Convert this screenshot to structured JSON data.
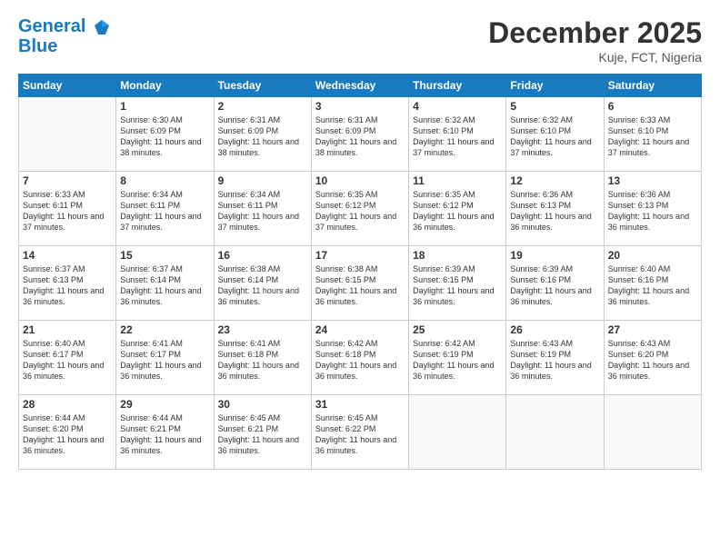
{
  "logo": {
    "line1": "General",
    "line2": "Blue"
  },
  "title": "December 2025",
  "location": "Kuje, FCT, Nigeria",
  "days_of_week": [
    "Sunday",
    "Monday",
    "Tuesday",
    "Wednesday",
    "Thursday",
    "Friday",
    "Saturday"
  ],
  "weeks": [
    [
      {
        "day": "",
        "empty": true
      },
      {
        "day": "1",
        "sunrise": "Sunrise: 6:30 AM",
        "sunset": "Sunset: 6:09 PM",
        "daylight": "Daylight: 11 hours and 38 minutes."
      },
      {
        "day": "2",
        "sunrise": "Sunrise: 6:31 AM",
        "sunset": "Sunset: 6:09 PM",
        "daylight": "Daylight: 11 hours and 38 minutes."
      },
      {
        "day": "3",
        "sunrise": "Sunrise: 6:31 AM",
        "sunset": "Sunset: 6:09 PM",
        "daylight": "Daylight: 11 hours and 38 minutes."
      },
      {
        "day": "4",
        "sunrise": "Sunrise: 6:32 AM",
        "sunset": "Sunset: 6:10 PM",
        "daylight": "Daylight: 11 hours and 37 minutes."
      },
      {
        "day": "5",
        "sunrise": "Sunrise: 6:32 AM",
        "sunset": "Sunset: 6:10 PM",
        "daylight": "Daylight: 11 hours and 37 minutes."
      },
      {
        "day": "6",
        "sunrise": "Sunrise: 6:33 AM",
        "sunset": "Sunset: 6:10 PM",
        "daylight": "Daylight: 11 hours and 37 minutes."
      }
    ],
    [
      {
        "day": "7",
        "sunrise": "Sunrise: 6:33 AM",
        "sunset": "Sunset: 6:11 PM",
        "daylight": "Daylight: 11 hours and 37 minutes."
      },
      {
        "day": "8",
        "sunrise": "Sunrise: 6:34 AM",
        "sunset": "Sunset: 6:11 PM",
        "daylight": "Daylight: 11 hours and 37 minutes."
      },
      {
        "day": "9",
        "sunrise": "Sunrise: 6:34 AM",
        "sunset": "Sunset: 6:11 PM",
        "daylight": "Daylight: 11 hours and 37 minutes."
      },
      {
        "day": "10",
        "sunrise": "Sunrise: 6:35 AM",
        "sunset": "Sunset: 6:12 PM",
        "daylight": "Daylight: 11 hours and 37 minutes."
      },
      {
        "day": "11",
        "sunrise": "Sunrise: 6:35 AM",
        "sunset": "Sunset: 6:12 PM",
        "daylight": "Daylight: 11 hours and 36 minutes."
      },
      {
        "day": "12",
        "sunrise": "Sunrise: 6:36 AM",
        "sunset": "Sunset: 6:13 PM",
        "daylight": "Daylight: 11 hours and 36 minutes."
      },
      {
        "day": "13",
        "sunrise": "Sunrise: 6:36 AM",
        "sunset": "Sunset: 6:13 PM",
        "daylight": "Daylight: 11 hours and 36 minutes."
      }
    ],
    [
      {
        "day": "14",
        "sunrise": "Sunrise: 6:37 AM",
        "sunset": "Sunset: 6:13 PM",
        "daylight": "Daylight: 11 hours and 36 minutes."
      },
      {
        "day": "15",
        "sunrise": "Sunrise: 6:37 AM",
        "sunset": "Sunset: 6:14 PM",
        "daylight": "Daylight: 11 hours and 36 minutes."
      },
      {
        "day": "16",
        "sunrise": "Sunrise: 6:38 AM",
        "sunset": "Sunset: 6:14 PM",
        "daylight": "Daylight: 11 hours and 36 minutes."
      },
      {
        "day": "17",
        "sunrise": "Sunrise: 6:38 AM",
        "sunset": "Sunset: 6:15 PM",
        "daylight": "Daylight: 11 hours and 36 minutes."
      },
      {
        "day": "18",
        "sunrise": "Sunrise: 6:39 AM",
        "sunset": "Sunset: 6:15 PM",
        "daylight": "Daylight: 11 hours and 36 minutes."
      },
      {
        "day": "19",
        "sunrise": "Sunrise: 6:39 AM",
        "sunset": "Sunset: 6:16 PM",
        "daylight": "Daylight: 11 hours and 36 minutes."
      },
      {
        "day": "20",
        "sunrise": "Sunrise: 6:40 AM",
        "sunset": "Sunset: 6:16 PM",
        "daylight": "Daylight: 11 hours and 36 minutes."
      }
    ],
    [
      {
        "day": "21",
        "sunrise": "Sunrise: 6:40 AM",
        "sunset": "Sunset: 6:17 PM",
        "daylight": "Daylight: 11 hours and 36 minutes."
      },
      {
        "day": "22",
        "sunrise": "Sunrise: 6:41 AM",
        "sunset": "Sunset: 6:17 PM",
        "daylight": "Daylight: 11 hours and 36 minutes."
      },
      {
        "day": "23",
        "sunrise": "Sunrise: 6:41 AM",
        "sunset": "Sunset: 6:18 PM",
        "daylight": "Daylight: 11 hours and 36 minutes."
      },
      {
        "day": "24",
        "sunrise": "Sunrise: 6:42 AM",
        "sunset": "Sunset: 6:18 PM",
        "daylight": "Daylight: 11 hours and 36 minutes."
      },
      {
        "day": "25",
        "sunrise": "Sunrise: 6:42 AM",
        "sunset": "Sunset: 6:19 PM",
        "daylight": "Daylight: 11 hours and 36 minutes."
      },
      {
        "day": "26",
        "sunrise": "Sunrise: 6:43 AM",
        "sunset": "Sunset: 6:19 PM",
        "daylight": "Daylight: 11 hours and 36 minutes."
      },
      {
        "day": "27",
        "sunrise": "Sunrise: 6:43 AM",
        "sunset": "Sunset: 6:20 PM",
        "daylight": "Daylight: 11 hours and 36 minutes."
      }
    ],
    [
      {
        "day": "28",
        "sunrise": "Sunrise: 6:44 AM",
        "sunset": "Sunset: 6:20 PM",
        "daylight": "Daylight: 11 hours and 36 minutes."
      },
      {
        "day": "29",
        "sunrise": "Sunrise: 6:44 AM",
        "sunset": "Sunset: 6:21 PM",
        "daylight": "Daylight: 11 hours and 36 minutes."
      },
      {
        "day": "30",
        "sunrise": "Sunrise: 6:45 AM",
        "sunset": "Sunset: 6:21 PM",
        "daylight": "Daylight: 11 hours and 36 minutes."
      },
      {
        "day": "31",
        "sunrise": "Sunrise: 6:45 AM",
        "sunset": "Sunset: 6:22 PM",
        "daylight": "Daylight: 11 hours and 36 minutes."
      },
      {
        "day": "",
        "empty": true
      },
      {
        "day": "",
        "empty": true
      },
      {
        "day": "",
        "empty": true
      }
    ]
  ]
}
